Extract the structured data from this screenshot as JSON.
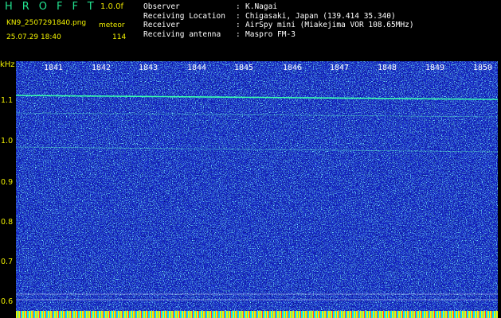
{
  "app": {
    "title": "HROFFT",
    "version": "1.0.0f",
    "filename": "KN9_2507291840.png",
    "mode": "meteor",
    "datetime": "25.07.29 18:40",
    "count": "114"
  },
  "info": [
    {
      "label": "Observer",
      "value": "K.Nagai"
    },
    {
      "label": "Receiving Location",
      "value": "Chigasaki, Japan (139.414 35.340)"
    },
    {
      "label": "Receiver",
      "value": "AirSpy mini (Miakejima VOR 108.65MHz)"
    },
    {
      "label": "Receiving antenna",
      "value": "Maspro FM-3"
    }
  ],
  "axis": {
    "unit": "kHz",
    "y_ticks": [
      "1.1",
      "1.0",
      "0.9",
      "0.8",
      "0.7",
      "0.6"
    ],
    "minutes": [
      "1841",
      "1842",
      "1843",
      "1844",
      "1845",
      "1846",
      "1847",
      "1848",
      "1849",
      "1850"
    ]
  },
  "colors": {
    "background": "#000000",
    "spectrum": "#1426c8",
    "trace": "#39ffb0",
    "label": "#f0f000"
  }
}
